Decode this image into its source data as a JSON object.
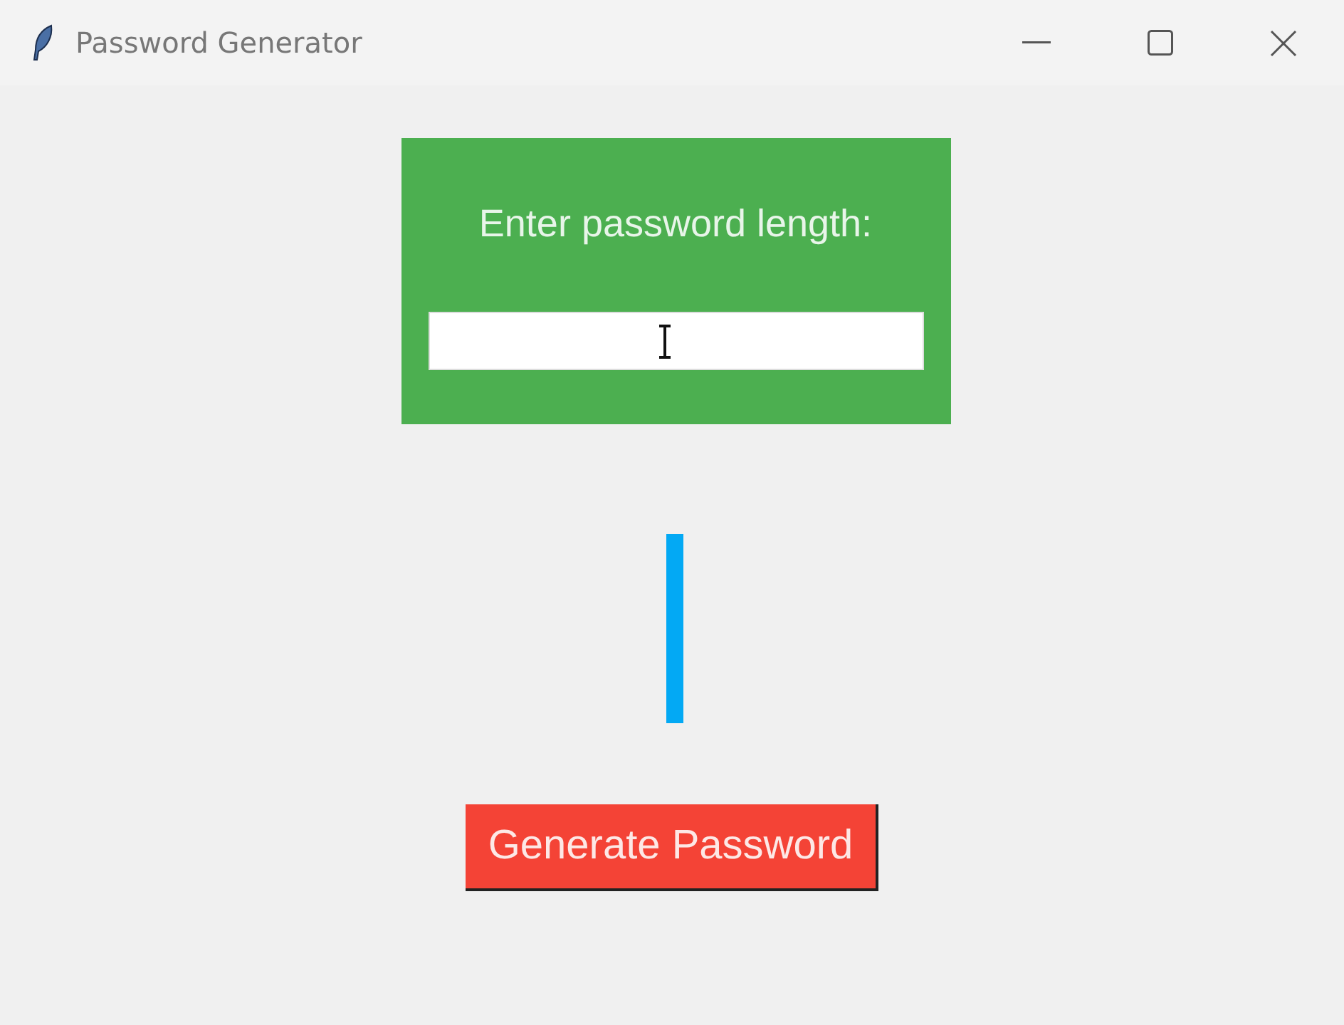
{
  "window": {
    "title": "Password Generator"
  },
  "form": {
    "label": "Enter password length:"
  },
  "button": {
    "label": "Generate Password"
  }
}
